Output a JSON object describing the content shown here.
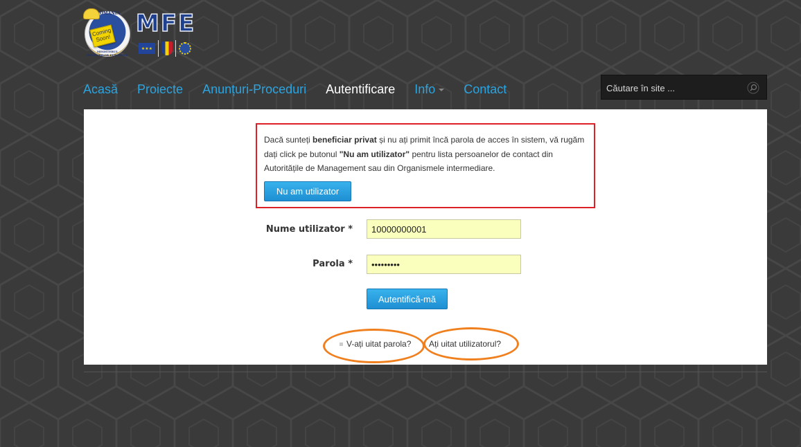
{
  "logo": {
    "seal_top_text": "ROMANIA",
    "seal_bottom_text": "MINISTERUL FONDURILOR EUROPENE",
    "badge_line1": "Coming",
    "badge_line2": "Soon!",
    "brand": "MFE"
  },
  "nav": {
    "items": [
      "Acasă",
      "Proiecte",
      "Anunțuri-Proceduri",
      "Autentificare",
      "Info",
      "Contact"
    ],
    "active": "Autentificare"
  },
  "search": {
    "placeholder": "Căutare în site ..."
  },
  "notice": {
    "part1": "Dacă sunteți ",
    "bold1": "beneficiar privat",
    "part2": " și nu ați primit încă parola de acces în sistem, vă rugăm dați click pe butonul ",
    "bold2": "\"Nu am utilizator\"",
    "part3": " pentru lista persoanelor de contact din Autoritățile de Management sau din Organismele intermediare.",
    "button": "Nu am utilizator"
  },
  "form": {
    "username_label": "Nume utilizator *",
    "username_value": "10000000001",
    "password_label": "Parola *",
    "password_value": "password1",
    "submit": "Autentifică-mă"
  },
  "links": {
    "forgot_password": "V-ați uitat parola?",
    "forgot_username": "Ați uitat utilizatorul?"
  },
  "colors": {
    "link": "#2ba4e0",
    "button": "#2899dc",
    "notice_border": "#dd1f26",
    "highlight": "#f07f1e"
  }
}
